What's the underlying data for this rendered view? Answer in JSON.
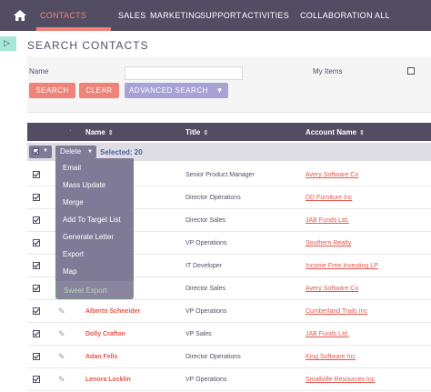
{
  "nav": {
    "items": [
      "CONTACTS",
      "SALES",
      "MARKETING",
      "SUPPORT",
      "ACTIVITIES",
      "COLLABORATION",
      "ALL"
    ],
    "active": "CONTACTS",
    "home_icon": "home-icon"
  },
  "page": {
    "title": "SEARCH CONTACTS"
  },
  "search": {
    "name_label": "Name",
    "name_value": "",
    "my_items_label": "My Items",
    "search_label": "SEARCH",
    "clear_label": "CLEAR",
    "advanced_label": "ADVANCED SEARCH"
  },
  "table": {
    "headers": {
      "name": "Name",
      "title": "Title",
      "account": "Account Name"
    },
    "sort_glyph": "⇕"
  },
  "bulk": {
    "action_label": "Delete",
    "selected_text": "Selected: 20"
  },
  "dropdown": {
    "items": [
      "Email",
      "Mass Update",
      "Merge",
      "Add To Target List",
      "Generate Letter",
      "Export",
      "Map",
      "Sweet Export"
    ],
    "highlighted": "Sweet Export"
  },
  "rows": [
    {
      "name": "",
      "title": "Senior Product Manager",
      "account": "Avery Software Co"
    },
    {
      "name": "",
      "title": "Director Operations",
      "account": "DD Furniture Inc"
    },
    {
      "name": "",
      "title": "Director Sales",
      "account": "JAB Funds Ltd."
    },
    {
      "name": "",
      "title": "VP Operations",
      "account": "Southern Realty"
    },
    {
      "name": "",
      "title": "IT Developer",
      "account": "Income Free Investing LP"
    },
    {
      "name": "",
      "title": "Director Sales",
      "account": "Avery Software Co"
    },
    {
      "name": "Alberto Schneider",
      "title": "VP Operations",
      "account": "Cumberland Trails Inc"
    },
    {
      "name": "Dolly Crafton",
      "title": "VP Sales",
      "account": "JAB Funds Ltd."
    },
    {
      "name": "Adan Fells",
      "title": "Director Operations",
      "account": "King Software Inc"
    },
    {
      "name": "Lenora Locklin",
      "title": "VP Operations",
      "account": "Smallville Resources Inc"
    }
  ],
  "colors": {
    "nav_bg": "#534d64",
    "accent": "#f08377",
    "adv_button": "#a9a2d6",
    "dropdown_bg": "#7f7a96",
    "link": "#e2574c"
  }
}
